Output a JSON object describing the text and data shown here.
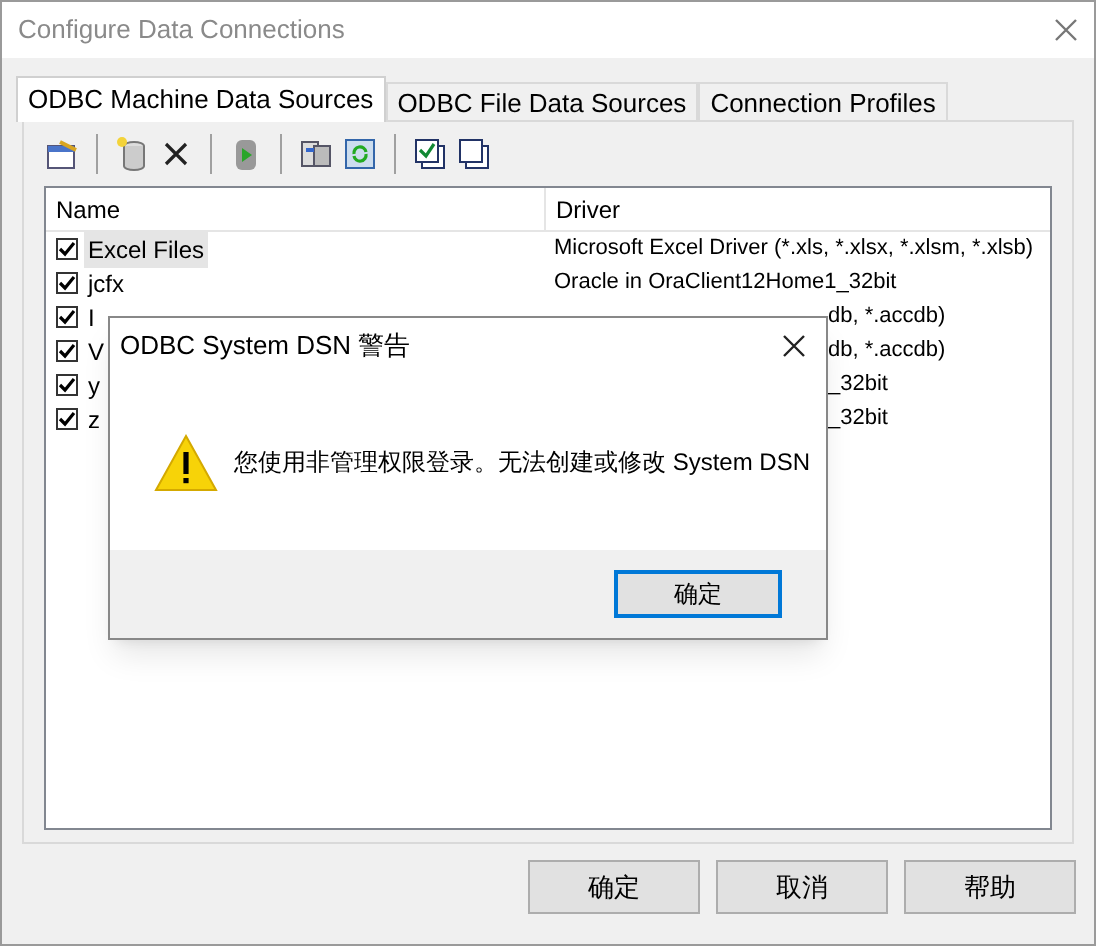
{
  "window": {
    "title": "Configure Data Connections"
  },
  "tabs": [
    {
      "label": "ODBC Machine Data Sources",
      "selected": true
    },
    {
      "label": "ODBC File Data Sources",
      "selected": false
    },
    {
      "label": "Connection Profiles",
      "selected": false
    }
  ],
  "table": {
    "columns": [
      "Name",
      "Driver"
    ],
    "rows": [
      {
        "name": "Excel Files",
        "driver": "Microsoft Excel Driver (*.xls, *.xlsx, *.xlsm, *.xlsb)",
        "checked": true,
        "selected": true,
        "kind": "full"
      },
      {
        "name": "jcfx",
        "driver": "Oracle in OraClient12Home1_32bit",
        "checked": true,
        "selected": false,
        "kind": "full"
      },
      {
        "name": "I",
        "driver": "db, *.accdb)",
        "checked": true,
        "selected": false,
        "kind": "covered"
      },
      {
        "name": "V",
        "driver": "db, *.accdb)",
        "checked": true,
        "selected": false,
        "kind": "covered"
      },
      {
        "name": "y",
        "driver": "_32bit",
        "checked": true,
        "selected": false,
        "kind": "covered"
      },
      {
        "name": "z",
        "driver": "_32bit",
        "checked": true,
        "selected": false,
        "kind": "covered"
      }
    ]
  },
  "dialog": {
    "title": "ODBC System DSN 警告",
    "message": "您使用非管理权限登录。无法创建或修改 System DSN",
    "button": "确定"
  },
  "buttons": [
    "确定",
    "取消",
    "帮助"
  ]
}
